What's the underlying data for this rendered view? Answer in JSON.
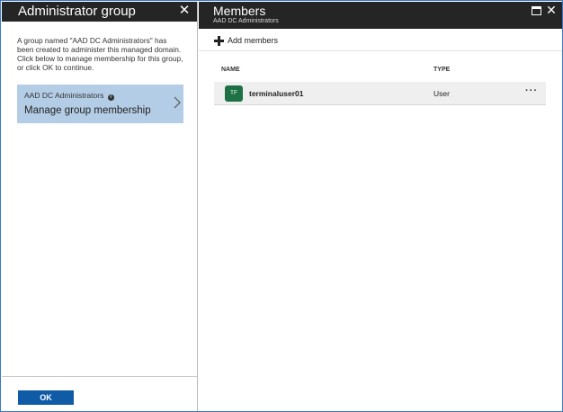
{
  "left_blade": {
    "title": "Administrator group",
    "description": "A group named \"AAD DC Administrators\" has been created to administer this managed domain. Click below to manage membership for this group, or click OK to continue.",
    "group_card": {
      "group_name": "AAD DC Administrators",
      "info_icon": "i",
      "action_label": "Manage group membership"
    },
    "ok_label": "OK"
  },
  "right_blade": {
    "title": "Members",
    "subtitle": "AAD DC Administrators",
    "toolbar": {
      "add_members_label": "Add members"
    },
    "table": {
      "columns": [
        "NAME",
        "TYPE"
      ],
      "rows": [
        {
          "initials": "TF",
          "name": "terminaluser01",
          "type": "User",
          "avatar_color": "#1e7145"
        }
      ]
    }
  },
  "colors": {
    "header_bg": "#252526",
    "selected_card": "#b4cde6",
    "primary_button": "#0f5ba6",
    "frame_border": "#3a78c4"
  }
}
